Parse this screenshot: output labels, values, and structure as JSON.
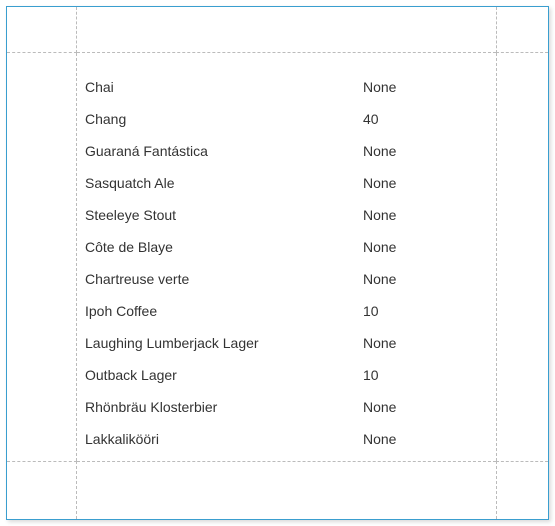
{
  "rows": [
    {
      "name": "Chai",
      "value": "None"
    },
    {
      "name": "Chang",
      "value": "40"
    },
    {
      "name": "Guaraná Fantástica",
      "value": "None"
    },
    {
      "name": "Sasquatch Ale",
      "value": "None"
    },
    {
      "name": "Steeleye Stout",
      "value": "None"
    },
    {
      "name": "Côte de Blaye",
      "value": "None"
    },
    {
      "name": "Chartreuse verte",
      "value": "None"
    },
    {
      "name": "Ipoh Coffee",
      "value": "10"
    },
    {
      "name": "Laughing Lumberjack Lager",
      "value": "None"
    },
    {
      "name": "Outback Lager",
      "value": "10"
    },
    {
      "name": "Rhönbräu Klosterbier",
      "value": "None"
    },
    {
      "name": "Lakkalikööri",
      "value": "None"
    }
  ]
}
